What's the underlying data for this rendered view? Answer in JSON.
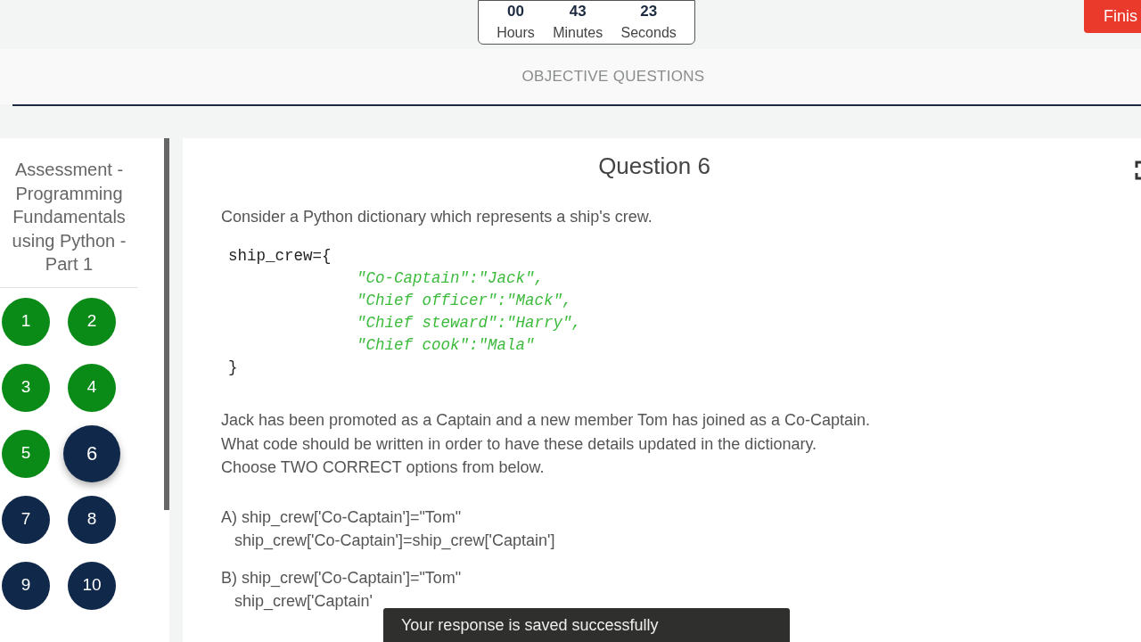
{
  "timer": {
    "values": [
      "00",
      "43",
      "23"
    ],
    "units": [
      "Hours",
      "Minutes",
      "Seconds"
    ]
  },
  "finish_button": "Finis",
  "section_title": "OBJECTIVE QUESTIONS",
  "sidebar": {
    "title": "Assessment - Programming Fundamentals using Python - Part 1",
    "questions": [
      {
        "label": "1",
        "answered": true,
        "selected": false
      },
      {
        "label": "2",
        "answered": true,
        "selected": false
      },
      {
        "label": "3",
        "answered": true,
        "selected": false
      },
      {
        "label": "4",
        "answered": true,
        "selected": false
      },
      {
        "label": "5",
        "answered": true,
        "selected": false
      },
      {
        "label": "6",
        "answered": false,
        "selected": true
      },
      {
        "label": "7",
        "answered": false,
        "selected": false
      },
      {
        "label": "8",
        "answered": false,
        "selected": false
      },
      {
        "label": "9",
        "answered": false,
        "selected": false
      },
      {
        "label": "10",
        "answered": false,
        "selected": false
      }
    ]
  },
  "question": {
    "title": "Question 6",
    "intro": "Consider a Python dictionary which represents a ship's crew.",
    "code": {
      "head": "ship_crew={",
      "entries": [
        "\"Co-Captain\":\"Jack\",",
        "\"Chief officer\":\"Mack\",",
        "\"Chief steward\":\"Harry\",",
        "\"Chief cook\":\"Mala\""
      ],
      "tail": "}"
    },
    "text": "Jack has been promoted as a Captain and a new member Tom has joined as a Co-Captain.\nWhat code should be written in order to have these details updated in the dictionary.\nChoose TWO CORRECT options from below.",
    "options": [
      {
        "lines": [
          "A) ship_crew['Co-Captain']=\"Tom\"",
          "ship_crew['Co-Captain']=ship_crew['Captain']"
        ]
      },
      {
        "lines": [
          "B) ship_crew['Co-Captain']=\"Tom\"",
          "ship_crew['Captain'"
        ]
      }
    ]
  },
  "toast": "Your response is saved successfully"
}
